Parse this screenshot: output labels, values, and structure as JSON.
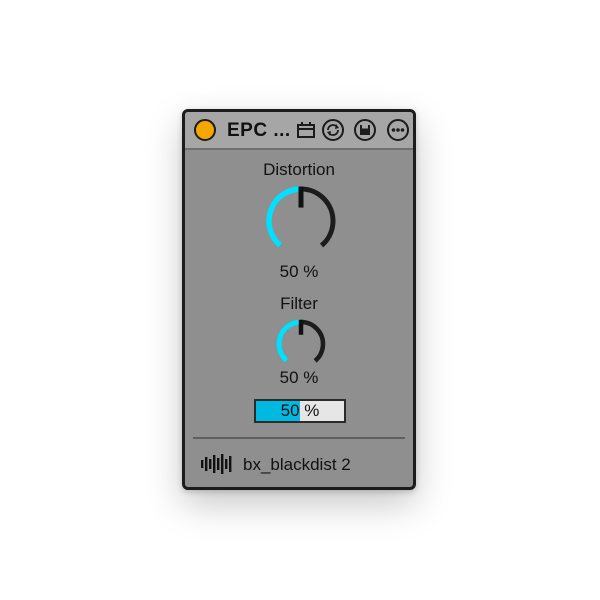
{
  "device": {
    "title": "EPC ...",
    "power_on": true,
    "icons": [
      "clipboard-icon",
      "sync-icon",
      "save-icon",
      "more-icon"
    ],
    "name": "bx_blackdist 2",
    "footer_icon": "waveform-icon"
  },
  "controls": {
    "distortion": {
      "label": "Distortion",
      "value": "50 %",
      "level": 0.5
    },
    "filter": {
      "label": "Filter",
      "value": "50 %",
      "level": 0.5
    },
    "slider": {
      "value": "50 %",
      "level": 0.5
    }
  },
  "colors": {
    "accent": "#00e0ff",
    "slider_fill": "#00b8e0",
    "power": "#f5a700",
    "track": "#1c1c1c",
    "panel": "#8f8f8f"
  }
}
